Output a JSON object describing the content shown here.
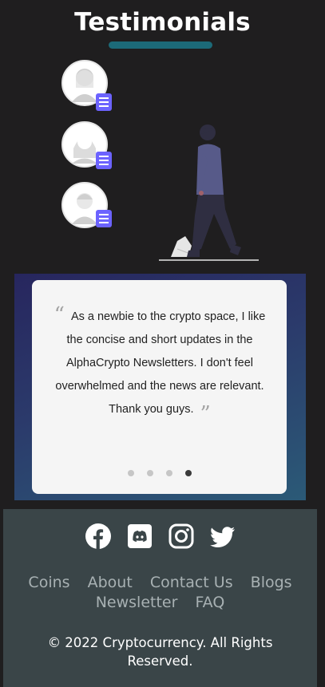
{
  "section": {
    "title": "Testimonials"
  },
  "illustration": {
    "avatars": [
      "avatar-woman-1",
      "avatar-woman-2",
      "avatar-man"
    ],
    "badge_icon": "document-icon",
    "figure": "walking-person"
  },
  "testimonial": {
    "open_quote": "“",
    "text": "As a newbie to the crypto space, I like the concise and short updates in the AlphaCrypto Newsletters. I don't feel overwhelmed and the news are relevant. Thank you guys.",
    "close_quote": "”",
    "active_slide": 4,
    "total_slides": 4
  },
  "footer": {
    "socials": [
      "facebook-icon",
      "discord-icon",
      "instagram-icon",
      "twitter-icon"
    ],
    "links": [
      "Coins",
      "About",
      "Contact Us",
      "Blogs",
      "Newsletter",
      "FAQ"
    ],
    "copyright": "© 2022 Cryptocurrency. All Rights Reserved."
  },
  "colors": {
    "background": "#1f1e1f",
    "accent": "#1c6a78",
    "badge": "#6c63ff",
    "footer_bg": "#3a4548"
  }
}
